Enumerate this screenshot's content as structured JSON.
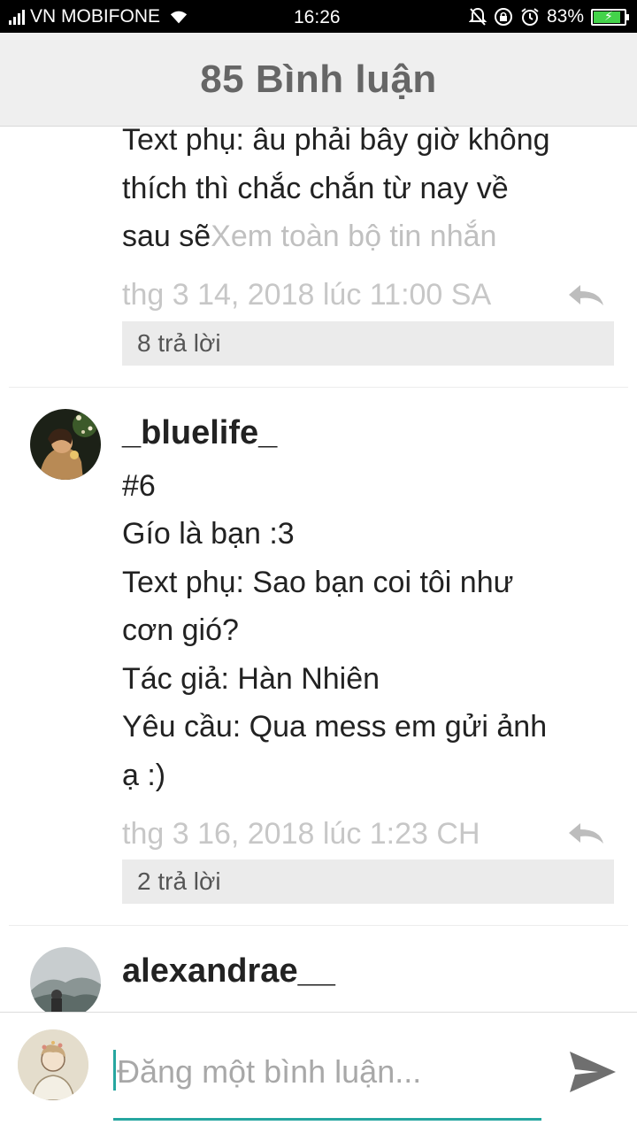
{
  "status_bar": {
    "carrier": "VN MOBIFONE",
    "time": "16:26",
    "battery": "83%"
  },
  "header": {
    "title": "85 Bình luận"
  },
  "comments": [
    {
      "author": "",
      "lines": [
        "Text phụ: âu phải bây giờ không",
        "thích thì chắc chắn từ nay về",
        "sau sẽ"
      ],
      "see_more": "Xem toàn bộ tin nhắn",
      "date": "thg 3 14, 2018 lúc 11:00 SA",
      "replies": "8 trả lời"
    },
    {
      "author": "_bluelife_",
      "lines": [
        "#6",
        "Gío là bạn :3",
        "Text phụ: Sao bạn coi tôi như",
        "cơn gió?",
        "Tác giả: Hàn Nhiên",
        "Yêu cầu: Qua mess em gửi ảnh",
        "ạ :)"
      ],
      "date": "thg 3 16, 2018 lúc 1:23 CH",
      "replies": "2 trả lời"
    },
    {
      "author": "alexandrae__"
    }
  ],
  "composer": {
    "placeholder": "Đăng một bình luận..."
  },
  "icons": {
    "reply": "reply-icon",
    "send": "send-icon",
    "wifi": "wifi-icon",
    "alarm": "alarm-icon"
  },
  "colors": {
    "accent": "#26a6a0",
    "header_bg": "#efefef",
    "muted_text": "#c7c7c7",
    "battery": "#44d34a"
  }
}
